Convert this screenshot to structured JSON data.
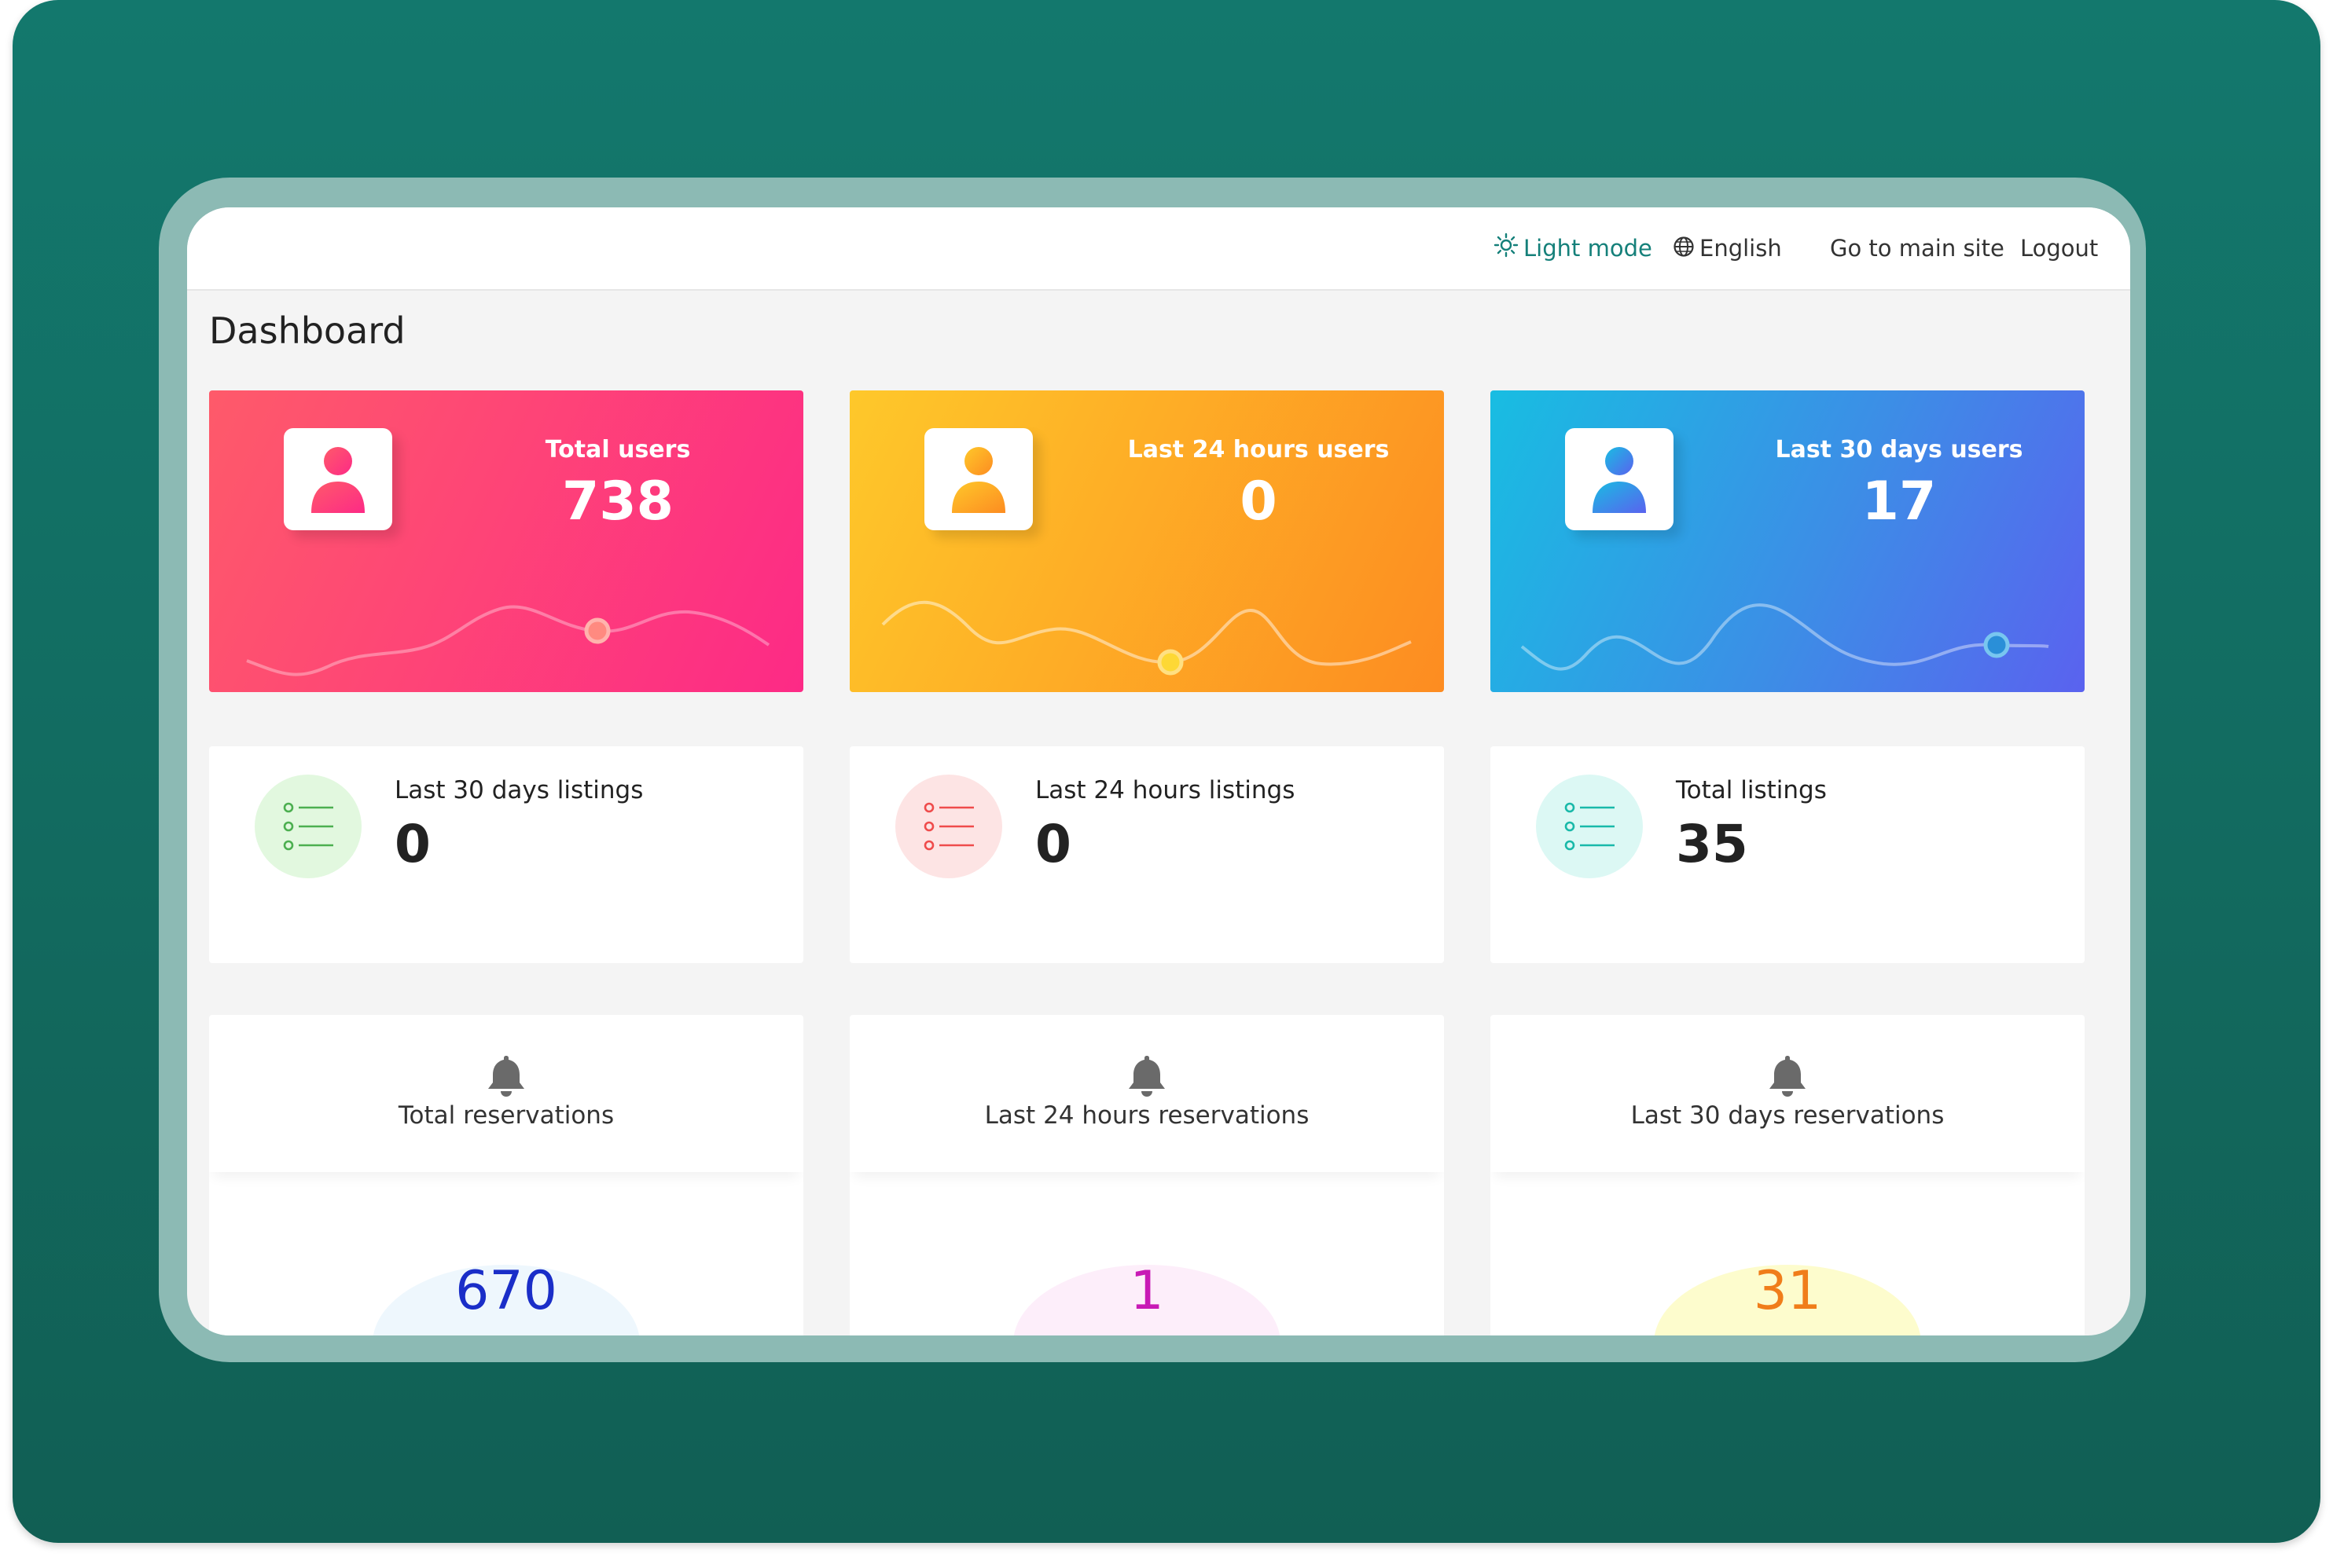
{
  "topbar": {
    "light_mode": "Light mode",
    "language": "English",
    "main_site": "Go to main site",
    "logout": "Logout"
  },
  "page": {
    "title": "Dashboard"
  },
  "user_cards": [
    {
      "label": "Total users",
      "value": "738",
      "gradient": [
        "#fe5a6a",
        "#fd2a86"
      ]
    },
    {
      "label": "Last 24 hours users",
      "value": "0",
      "gradient": [
        "#fec82a",
        "#fd8c21"
      ]
    },
    {
      "label": "Last 30 days users",
      "value": "17",
      "gradient": [
        "#18bde2",
        "#5a62ef"
      ]
    }
  ],
  "listing_cards": [
    {
      "label": "Last 30 days listings",
      "value": "0",
      "icon": "list-icon",
      "color": "#4caf50",
      "bg": "#e2f8df"
    },
    {
      "label": "Last 24 hours listings",
      "value": "0",
      "icon": "list-icon",
      "color": "#ef4c4c",
      "bg": "#fde4e4"
    },
    {
      "label": "Total listings",
      "value": "35",
      "icon": "list-icon",
      "color": "#19b9a9",
      "bg": "#dcf8f4"
    }
  ],
  "reservation_cards": [
    {
      "label": "Total reservations",
      "value": "670",
      "icon": "bell-icon",
      "color": "#1a2ec8"
    },
    {
      "label": "Last 24 hours reservations",
      "value": "1",
      "icon": "bell-icon",
      "color": "#c81ab5"
    },
    {
      "label": "Last 30 days reservations",
      "value": "31",
      "icon": "bell-icon",
      "color": "#f07d1a"
    }
  ]
}
